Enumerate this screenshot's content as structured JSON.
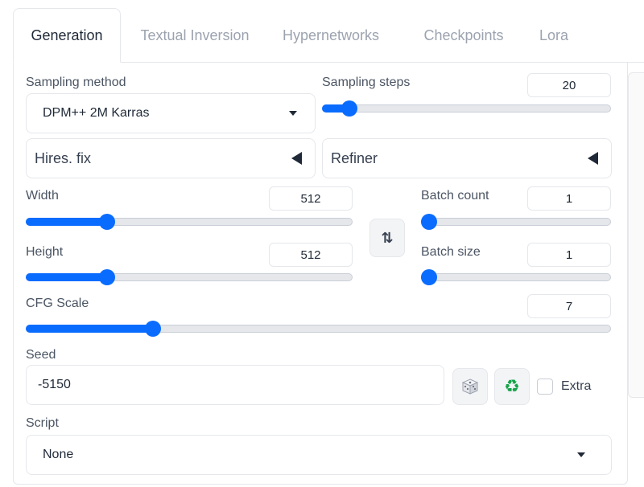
{
  "tabs": [
    {
      "label": "Generation",
      "active": true
    },
    {
      "label": "Textual Inversion",
      "active": false
    },
    {
      "label": "Hypernetworks",
      "active": false
    },
    {
      "label": "Checkpoints",
      "active": false
    },
    {
      "label": "Lora",
      "active": false
    }
  ],
  "sampling_method": {
    "label": "Sampling method",
    "value": "DPM++ 2M Karras",
    "icon": "chevron-down-icon"
  },
  "sampling_steps": {
    "label": "Sampling steps",
    "value": "20",
    "fraction": 0.07
  },
  "hires_fix": {
    "label": "Hires. fix",
    "icon": "triangle-left-icon"
  },
  "refiner": {
    "label": "Refiner",
    "icon": "triangle-left-icon"
  },
  "width": {
    "label": "Width",
    "value": "512",
    "fraction": 0.237
  },
  "height": {
    "label": "Height",
    "value": "512",
    "fraction": 0.237
  },
  "swap_dimensions": {
    "icon": "swap-vertical-icon",
    "glyph": "⇅"
  },
  "batch_count": {
    "label": "Batch count",
    "value": "1",
    "fraction": 0.0
  },
  "batch_size": {
    "label": "Batch size",
    "value": "1",
    "fraction": 0.0
  },
  "cfg_scale": {
    "label": "CFG Scale",
    "value": "7",
    "fraction": 0.21
  },
  "seed": {
    "label": "Seed",
    "value": "-5150",
    "random_icon": "dice-icon",
    "reuse_icon": "recycle-icon",
    "recycle_glyph": "♻",
    "extra_label": "Extra"
  },
  "script": {
    "label": "Script",
    "value": "None",
    "icon": "chevron-down-icon"
  },
  "colors": {
    "accent": "#0a6cff",
    "border": "#e5e7eb",
    "recycle": "#16a34a"
  }
}
